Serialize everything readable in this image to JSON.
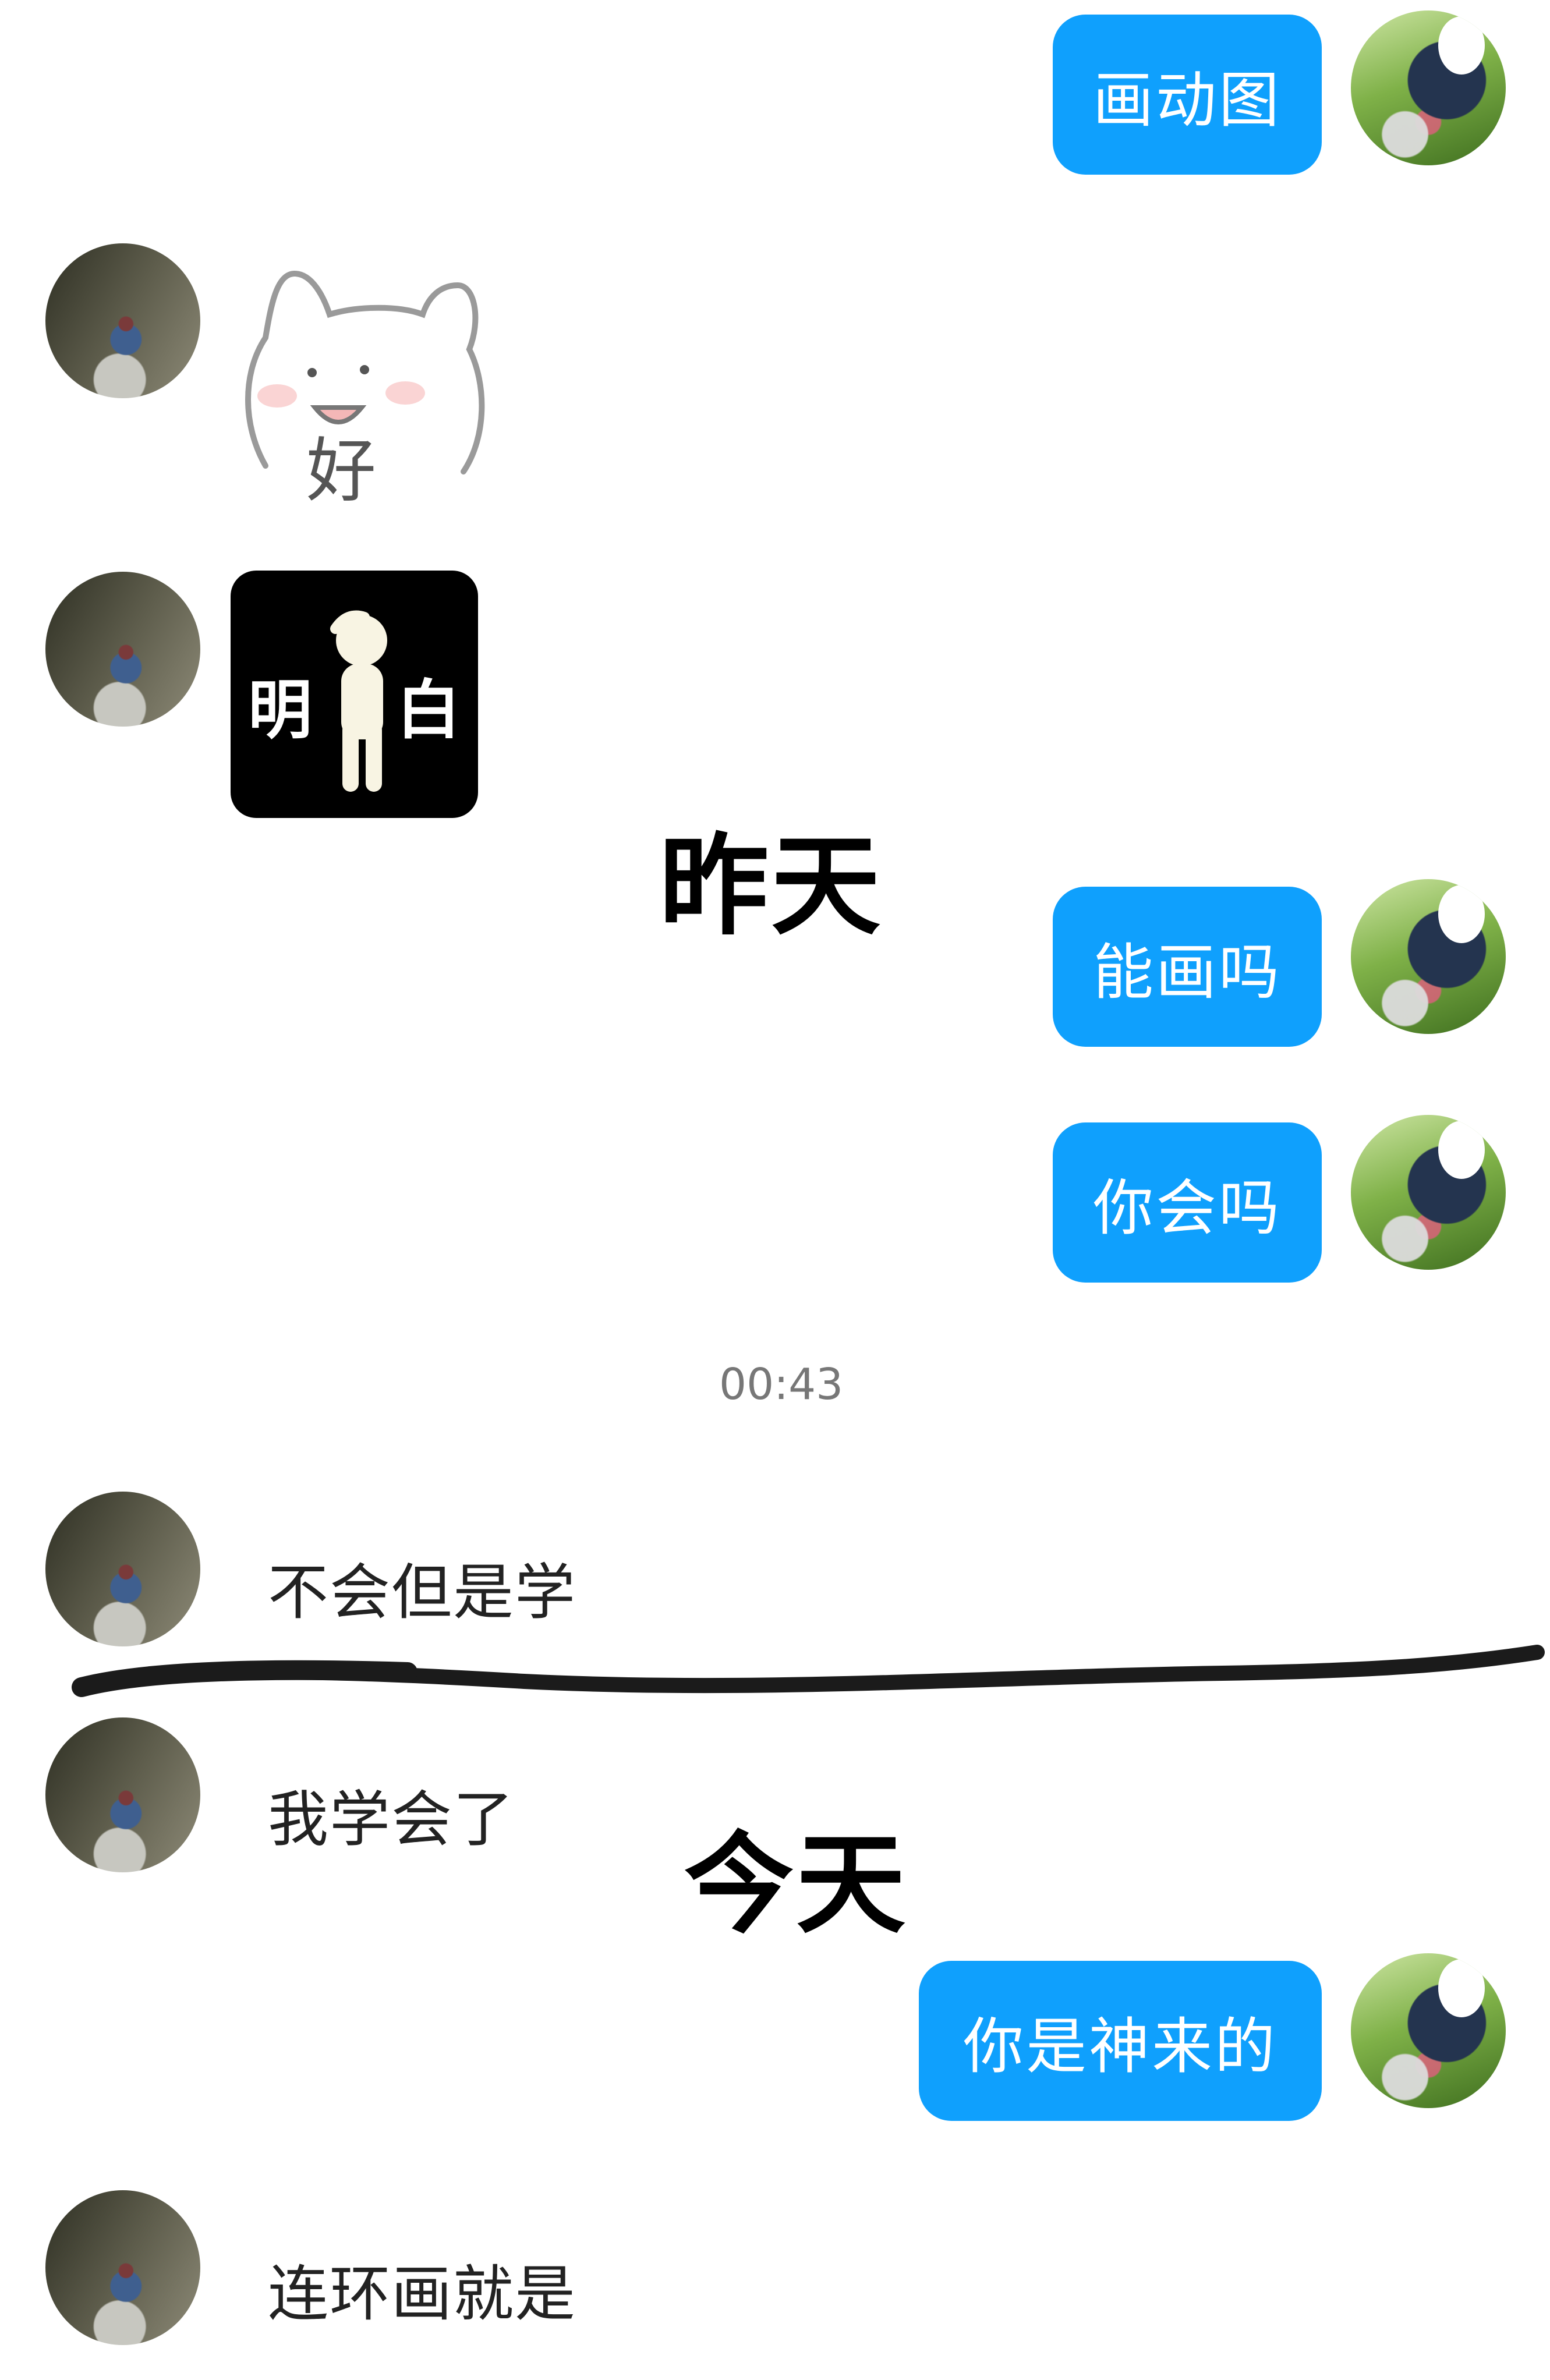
{
  "messages": {
    "m1": "画动图",
    "m4": "能画吗",
    "m5": "你会吗",
    "m6": "不会但是学",
    "m7": "我学会了",
    "m8": "你是神来的",
    "m9": "连环画就是"
  },
  "stickers": {
    "cat": {
      "text": "好"
    },
    "mingbai": {
      "left": "明",
      "right": "白"
    }
  },
  "timestamp": "00:43",
  "overlay": {
    "yesterday": "昨天",
    "today": "今天"
  },
  "colors": {
    "bubble": "#0fa0fd",
    "bubble_text": "#ffffff",
    "plain_text": "#222222",
    "timestamp": "#777777"
  },
  "icons": [
    "avatar-me",
    "avatar-other",
    "cat-sticker",
    "salute-sticker"
  ]
}
